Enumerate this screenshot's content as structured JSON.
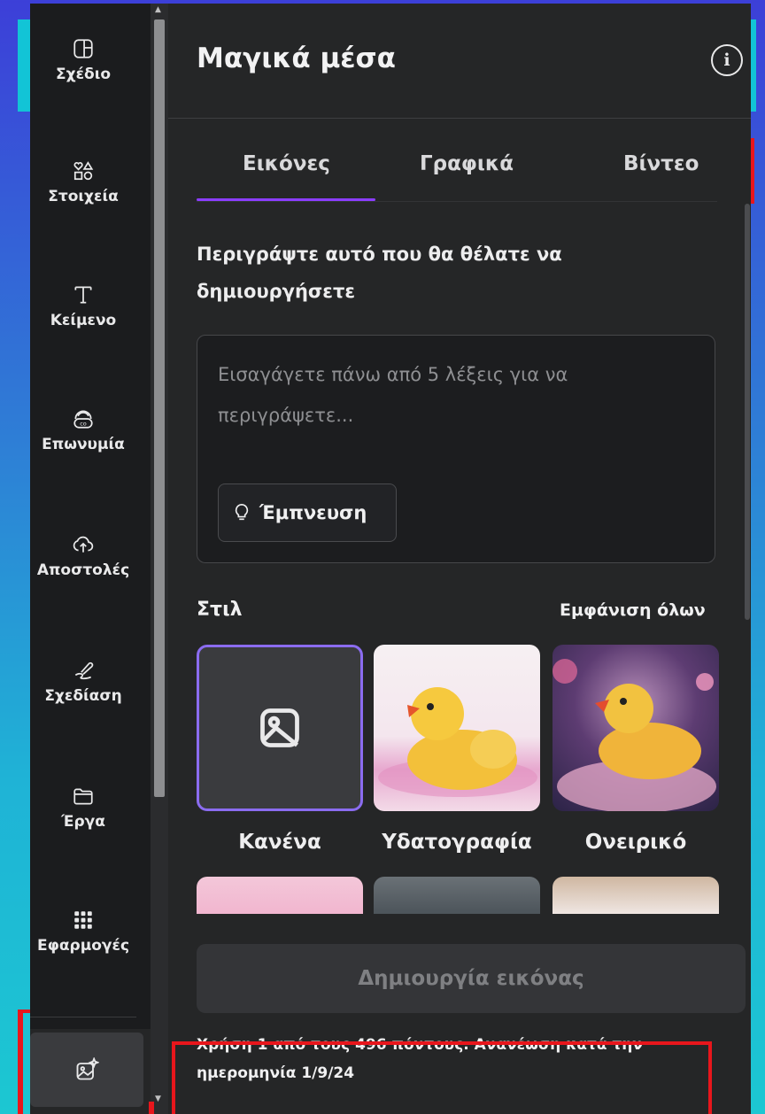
{
  "sidebar": {
    "items": [
      {
        "label": "Σχέδιο",
        "icon": "layout-icon"
      },
      {
        "label": "Στοιχεία",
        "icon": "shapes-icon"
      },
      {
        "label": "Κείμενο",
        "icon": "text-icon"
      },
      {
        "label": "Επωνυμία",
        "icon": "brand-icon"
      },
      {
        "label": "Αποστολές",
        "icon": "cloud-upload-icon"
      },
      {
        "label": "Σχεδίαση",
        "icon": "draw-icon"
      },
      {
        "label": "Έργα",
        "icon": "folder-icon"
      },
      {
        "label": "Εφαρμογές",
        "icon": "apps-grid-icon"
      }
    ],
    "active_icon": "magic-media-icon"
  },
  "panel": {
    "title": "Μαγικά μέσα",
    "tabs": [
      {
        "label": "Εικόνες",
        "active": true
      },
      {
        "label": "Γραφικά",
        "active": false
      },
      {
        "label": "Βίντεο",
        "active": false
      }
    ],
    "prompt_title": "Περιγράψτε αυτό που θα θέλατε να δημιουργήσετε",
    "prompt_placeholder": "Εισαγάγετε πάνω από 5 λέξεις για να περιγράψετε...",
    "inspire_label": "Έμπνευση",
    "style_title": "Στιλ",
    "show_all": "Εμφάνιση όλων",
    "styles": [
      {
        "label": "Κανένα",
        "selected": true
      },
      {
        "label": "Υδατογραφία",
        "selected": false
      },
      {
        "label": "Ονειρικό",
        "selected": false
      }
    ],
    "generate_label": "Δημιουργία εικόνας",
    "usage_text": "Χρήση 1 από τους 496 πόντους. Ανανέωση κατά την ημερομηνία 1/9/24"
  },
  "colors": {
    "accent": "#8b3dff",
    "highlight": "#e8161c",
    "panel_bg": "#252627",
    "sidebar_bg": "#1b1c1e"
  }
}
